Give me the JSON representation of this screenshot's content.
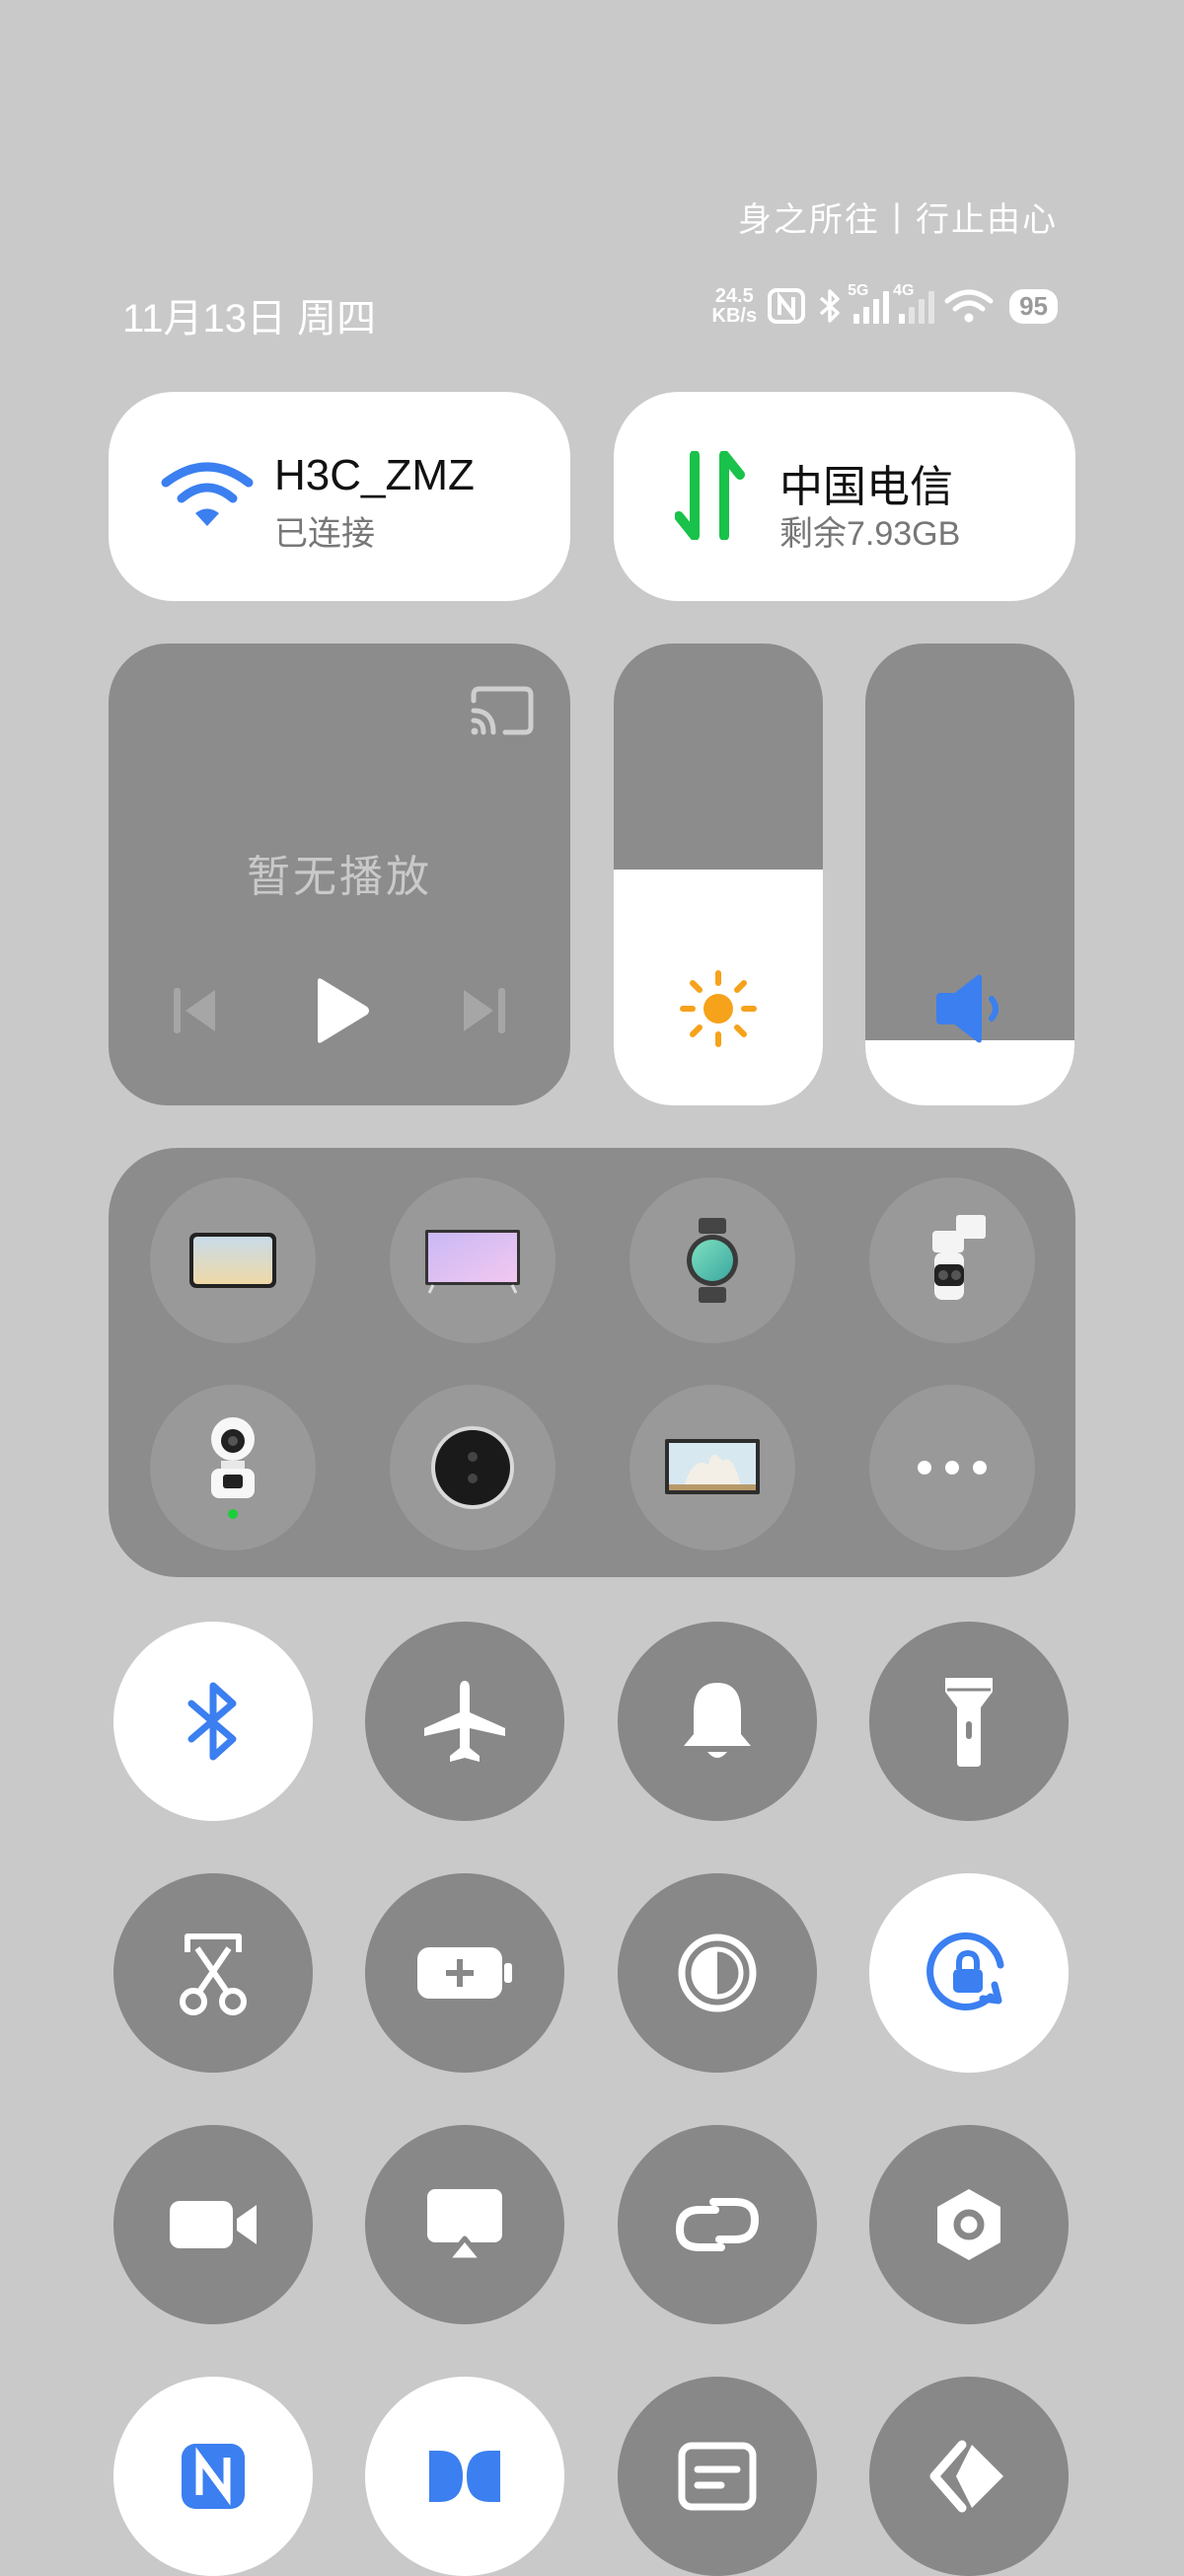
{
  "status_bar": {
    "motto": "身之所往丨行止由心",
    "date": "11月13日 周四",
    "net_speed_value": "24.5",
    "net_speed_unit": "KB/s",
    "sim1_label": "5G",
    "sim2_label": "4G",
    "battery": "95"
  },
  "wifi_card": {
    "name": "H3C_ZMZ",
    "status": "已连接"
  },
  "mobile_card": {
    "carrier": "中国电信",
    "remaining": "剩余7.93GB"
  },
  "media": {
    "status": "暂无播放"
  },
  "brightness": {
    "level": 0.51
  },
  "volume": {
    "level": 0.14
  },
  "devices": [
    {
      "icon": "tablet-icon"
    },
    {
      "icon": "tv-icon"
    },
    {
      "icon": "smartwatch-icon"
    },
    {
      "icon": "outdoor-camera-icon"
    },
    {
      "icon": "home-camera-icon"
    },
    {
      "icon": "speaker-icon"
    },
    {
      "icon": "aquarium-icon"
    },
    {
      "icon": "more-icon"
    }
  ],
  "toggles": [
    {
      "icon": "bluetooth-icon",
      "active": true
    },
    {
      "icon": "airplane-icon",
      "active": false
    },
    {
      "icon": "bell-icon",
      "active": false
    },
    {
      "icon": "flashlight-icon",
      "active": false
    },
    {
      "icon": "screenshot-icon",
      "active": false
    },
    {
      "icon": "battery-saver-icon",
      "active": false
    },
    {
      "icon": "dark-mode-icon",
      "active": false
    },
    {
      "icon": "rotation-lock-icon",
      "active": true
    },
    {
      "icon": "video-camera-icon",
      "active": false
    },
    {
      "icon": "screen-cast-icon",
      "active": false
    },
    {
      "icon": "link-icon",
      "active": false
    },
    {
      "icon": "hexagon-settings-icon",
      "active": false
    },
    {
      "icon": "nfc-icon",
      "active": true
    },
    {
      "icon": "dolby-icon",
      "active": true
    },
    {
      "icon": "notes-icon",
      "active": false
    },
    {
      "icon": "interconnect-icon",
      "active": false
    }
  ],
  "colors": {
    "accent_blue": "#3b7ff0",
    "data_green": "#19c24a",
    "sun_orange": "#f6a21a"
  }
}
